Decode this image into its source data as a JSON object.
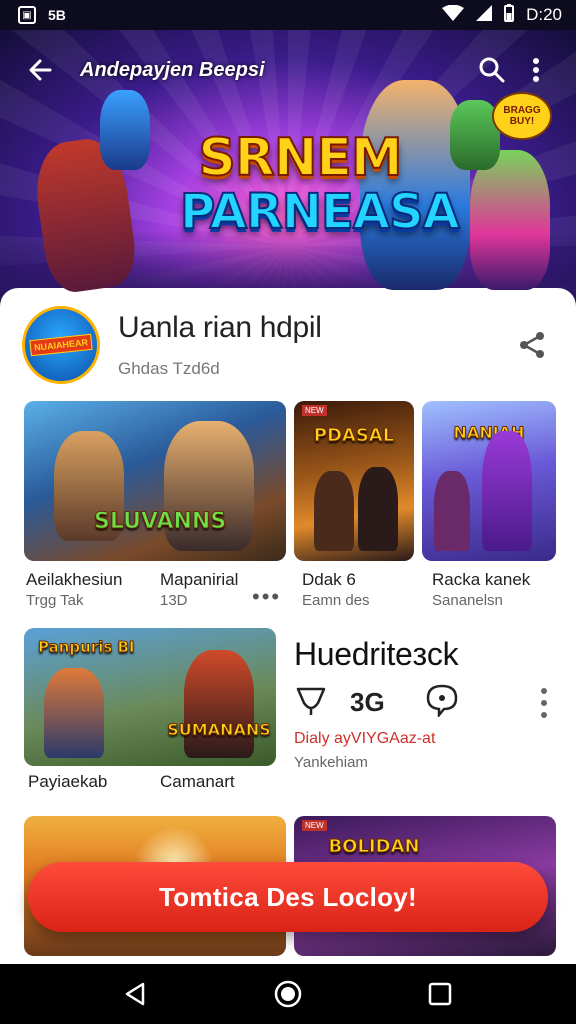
{
  "status_bar": {
    "time": "D:20",
    "left_icons": [
      "sim-box-icon",
      "notification-tag-icon"
    ],
    "right_icons": [
      "wifi-icon",
      "signal-icon",
      "battery-icon"
    ],
    "tag_label": "5B"
  },
  "hero": {
    "toolbar_title": "Andepayjen Beepsi",
    "logo_line1": "SRNEM",
    "logo_line2": "PARNEASA",
    "badge_text": "BRAGG BUY!"
  },
  "app": {
    "icon_label": "NUAIAHEAR",
    "title": "Uanla rian hdpil",
    "subtitle": "Ghdas Tzd6d"
  },
  "cards_row1": [
    {
      "thumb_title": "SLUVANNS",
      "title": "Aeilakhesiun",
      "sub": "Trgg Tak"
    },
    {
      "title": "Mapanirial",
      "sub": "13D"
    },
    {
      "thumb_title": "PDASAL",
      "title": "Ddak 6",
      "sub": "Eamn des"
    },
    {
      "thumb_title": "NANIAH",
      "title": "Racka kanek",
      "sub": "Sananelsn"
    }
  ],
  "cards_row2": [
    {
      "thumb_title": "SUMANANS",
      "thumb_top": "Panpuris BI",
      "title": "Payiaekab"
    },
    {
      "title": "Camanart"
    }
  ],
  "side": {
    "title": "Huedriteзck",
    "badge": "3G",
    "accent": "Dialy ayVIYGAaz-at",
    "sub": "Yankehiam"
  },
  "cards_row3": [
    {
      "thumb_title": ""
    },
    {
      "thumb_title": "BOLIDAN"
    }
  ],
  "cta": {
    "label": "Tomtica Des Locloy!"
  },
  "colors": {
    "accent_red": "#d92317",
    "hero_purple": "#3a1c8a",
    "gold": "#ffd21a"
  }
}
